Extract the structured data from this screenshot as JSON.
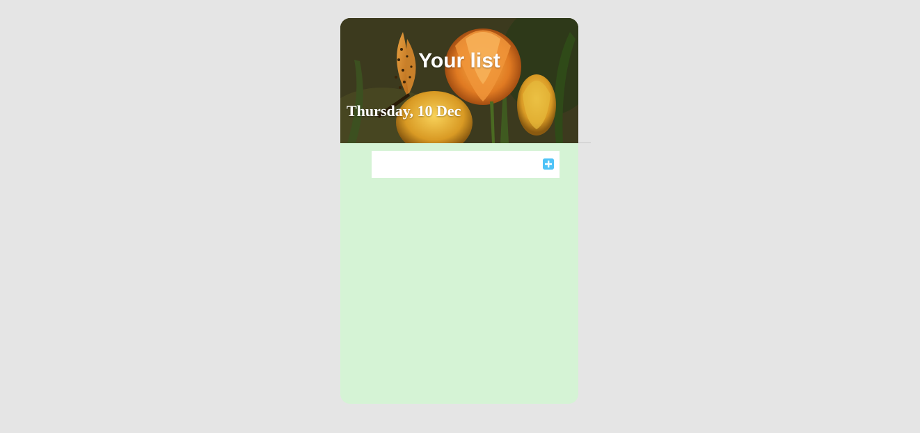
{
  "header": {
    "title": "Your list",
    "date": "Thursday, 10 Dec",
    "background_image": "butterfly-on-orange-tulips"
  },
  "add_task": {
    "input_value": "",
    "placeholder": "",
    "button_icon": "plus-square-icon",
    "button_color": "#4fc3f7"
  },
  "colors": {
    "page_background": "#e5e5e5",
    "list_background": "#d5f3d5",
    "accent": "#4fc3f7"
  },
  "tasks": []
}
